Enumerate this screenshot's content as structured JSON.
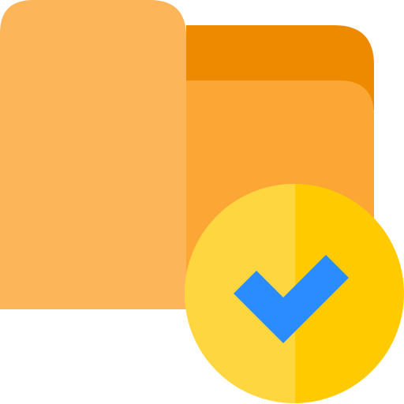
{
  "icon": {
    "name": "folder-checked-icon",
    "parts": [
      "folder-back-tab",
      "folder-back-panel",
      "folder-front-panel",
      "check-badge",
      "checkmark"
    ]
  },
  "colors": {
    "folder_front": "#FDB55A",
    "folder_back_panel": "#FCA636",
    "folder_back_tab": "#EE8A00",
    "badge_left": "#FED640",
    "badge_right": "#FFCA00",
    "checkmark": "#2A8CFF"
  }
}
